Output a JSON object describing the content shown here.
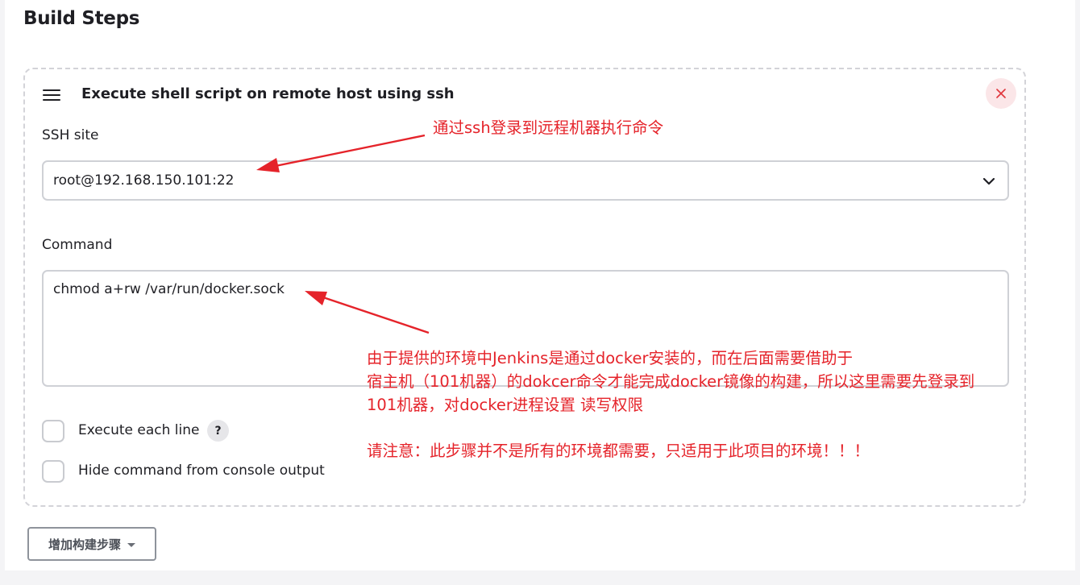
{
  "section": {
    "title": "Build Steps"
  },
  "step": {
    "title": "Execute shell script on remote host using ssh",
    "ssh_site_label": "SSH site",
    "ssh_site_value": "root@192.168.150.101:22",
    "command_label": "Command",
    "command_value": "chmod a+rw /var/run/docker.sock",
    "execute_each_line_label": "Execute each line",
    "execute_each_line_checked": false,
    "hide_command_label": "Hide command from console output",
    "hide_command_checked": false,
    "help_label": "?"
  },
  "add_step_button": {
    "label": "增加构建步骤"
  },
  "annotations": {
    "ssh": "通过ssh登录到远程机器执行命令",
    "command_lines": [
      "由于提供的环境中Jenkins是通过docker安装的，而在后面需要借助于",
      "宿主机（101机器）的dokcer命令才能完成docker镜像的构建，所以这里需要先登录到",
      "101机器，对docker进程设置 读写权限"
    ],
    "notice": "请注意：此步骤并不是所有的环境都需要，只适用于此项目的环境！！！"
  },
  "icons": {
    "drag_handle": "hamburger-icon",
    "close": "close-icon",
    "dropdown": "chevron-down-icon",
    "add_caret": "caret-down-icon"
  },
  "colors": {
    "annotation": "#e5232a",
    "close_bg": "#fbe6e8",
    "close_fg": "#e0353b"
  }
}
